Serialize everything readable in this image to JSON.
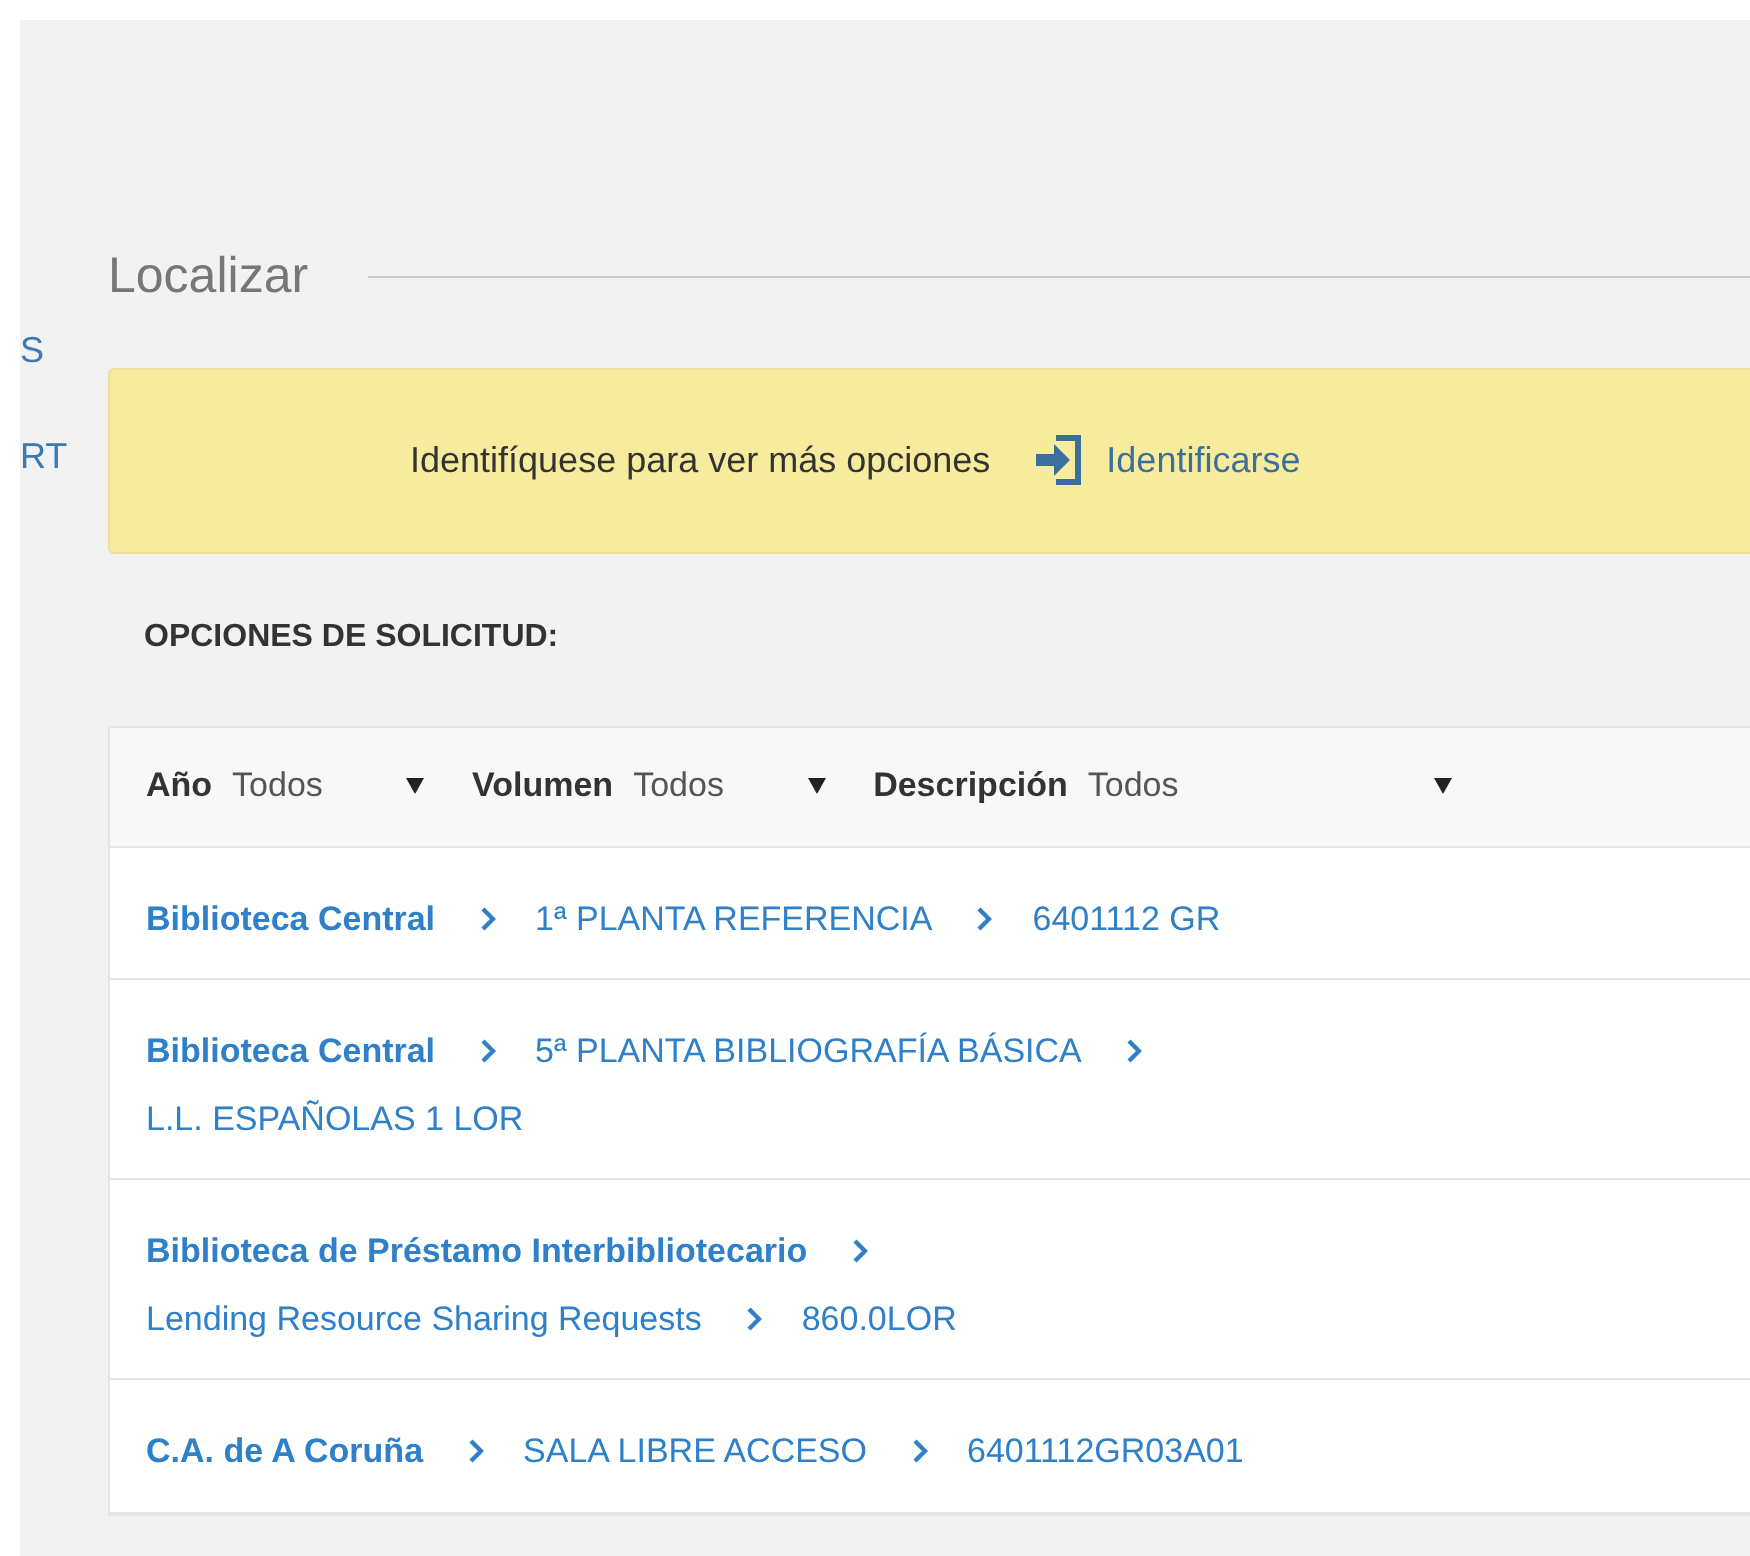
{
  "sidebar_fragments": [
    "S",
    "RT"
  ],
  "section_title": "Localizar",
  "login_notice": {
    "text": "Identifíquese para ver más opciones",
    "link": "Identificarse"
  },
  "request_options_label": "OPCIONES DE SOLICITUD:",
  "filters": [
    {
      "label": "Año",
      "value": "Todos"
    },
    {
      "label": "Volumen",
      "value": "Todos"
    },
    {
      "label": "Descripción",
      "value": "Todos"
    }
  ],
  "locations": [
    {
      "parts": [
        "Biblioteca Central",
        "1ª PLANTA REFERENCIA",
        "6401112 GR"
      ]
    },
    {
      "parts": [
        "Biblioteca Central",
        "5ª PLANTA BIBLIOGRAFÍA BÁSICA",
        "L.L. ESPAÑOLAS 1 LOR"
      ]
    },
    {
      "parts": [
        "Biblioteca de Préstamo Interbibliotecario",
        "Lending Resource Sharing Requests",
        "860.0LOR"
      ]
    },
    {
      "parts": [
        "C.A. de A Coruña",
        "SALA LIBRE ACCESO",
        "6401112GR03A01"
      ]
    }
  ]
}
